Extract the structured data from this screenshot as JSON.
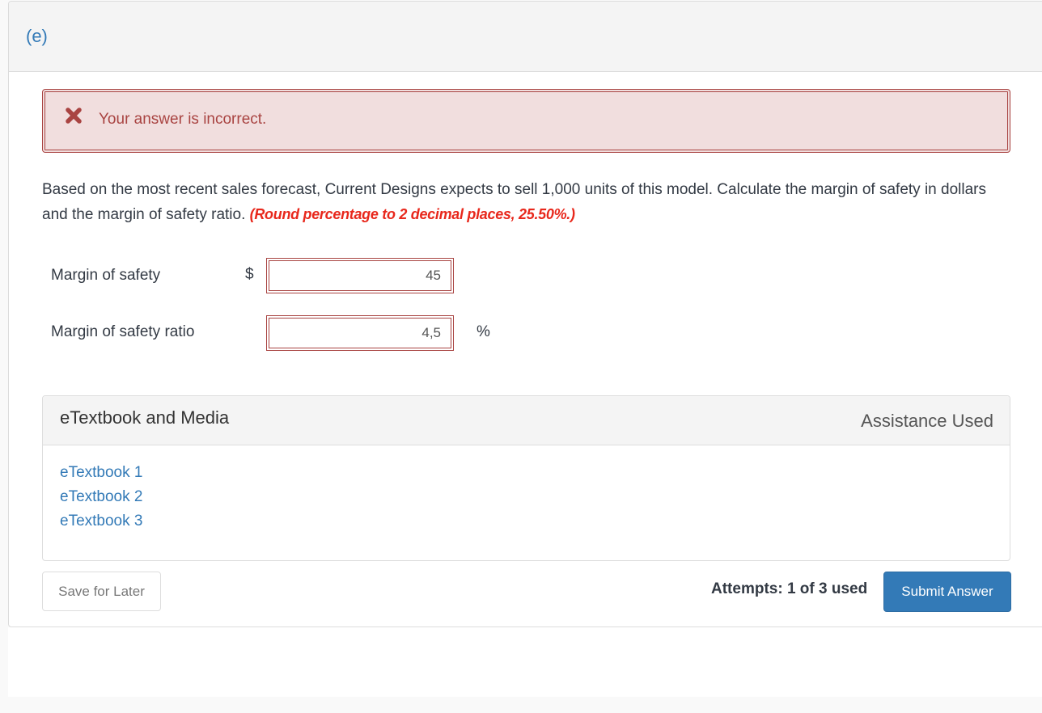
{
  "part": {
    "label": "(e)"
  },
  "alert": {
    "icon": "x-mark-icon",
    "message": "Your answer is incorrect.",
    "color": "#a94442",
    "background": "#f1dede"
  },
  "question": {
    "text": "Based on the most recent sales forecast, Current Designs expects to sell 1,000 units of this model. Calculate the margin of safety in dollars and the margin of safety ratio.",
    "hint": "(Round percentage to 2 decimal places, 25.50%.)",
    "hint_color": "#e8281c"
  },
  "fields": [
    {
      "label": "Margin of safety",
      "prefix": "$",
      "value": "45",
      "suffix": "",
      "status": "incorrect"
    },
    {
      "label": "Margin of safety ratio",
      "prefix": "",
      "value": "4,5",
      "suffix": "%",
      "status": "incorrect"
    }
  ],
  "media": {
    "title": "eTextbook and Media",
    "assistance": "Assistance Used",
    "links": [
      "eTextbook 1",
      "eTextbook 2",
      "eTextbook 3"
    ]
  },
  "footer": {
    "save_label": "Save for Later",
    "attempts": "Attempts: 1 of 3 used",
    "submit_label": "Submit Answer",
    "submit_color": "#337ab7"
  }
}
